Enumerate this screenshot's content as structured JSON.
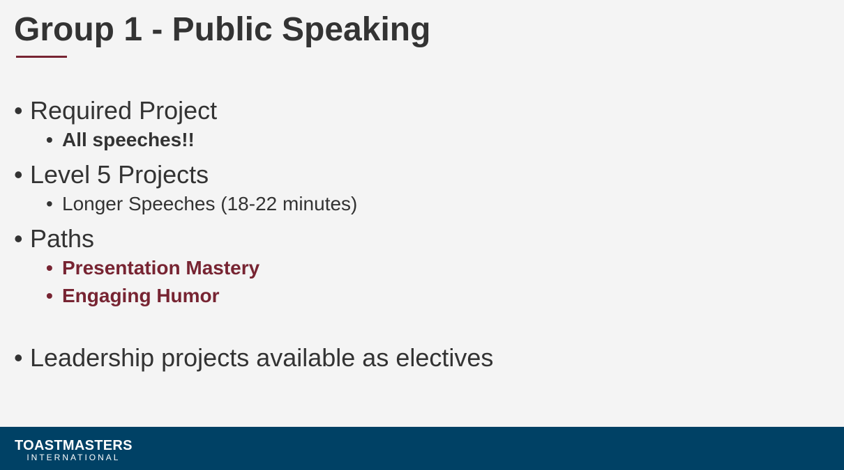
{
  "slide": {
    "title": "Group 1 - Public Speaking",
    "accent_color": "#772432",
    "bullets": [
      {
        "text": "Required Project",
        "level": 1
      },
      {
        "text": "All speeches!!",
        "level": 2,
        "bold": true
      },
      {
        "text": "Level 5 Projects",
        "level": 1
      },
      {
        "text": "Longer Speeches (18-22 minutes)",
        "level": 2
      },
      {
        "text": "Paths",
        "level": 1
      },
      {
        "text": "Presentation Mastery",
        "level": 2,
        "bold": true,
        "color": "#772432"
      },
      {
        "text": "Engaging Humor",
        "level": 2,
        "bold": true,
        "color": "#772432"
      },
      {
        "text": "Leadership projects available as electives",
        "level": 1
      }
    ],
    "bullet_glyph": "•"
  },
  "footer": {
    "background": "#004165",
    "logo_main": "TOASTMASTERS",
    "logo_sub": "INTERNATIONAL"
  }
}
